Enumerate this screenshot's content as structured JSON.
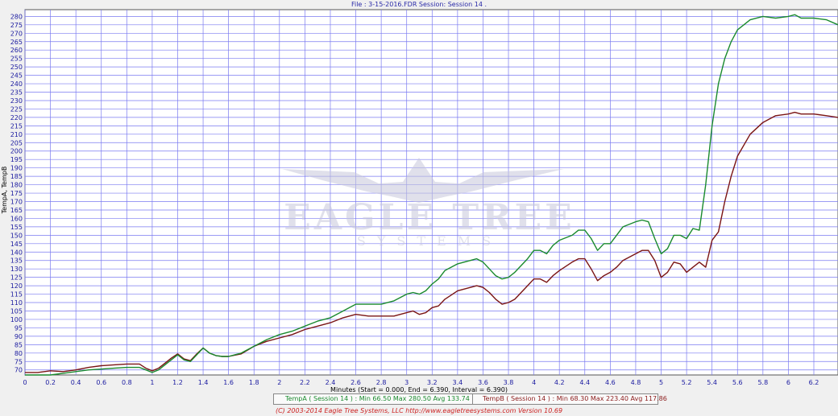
{
  "header": {
    "title": "File : 3-15-2016.FDR   Session: Session 14 ."
  },
  "legend": {
    "a": "TempA ( Session 14 ) : Min 66.50   Max 280.50   Avg 133.74",
    "b": "TempB ( Session 14 ) : Min 68.30   Max 223.40   Avg 117.86"
  },
  "footer": {
    "copyright": "(C) 2003-2014 Eagle Tree Systems, LLC  http://www.eagletreesystems.com  Version 10.69"
  },
  "watermark": {
    "line1": "EAGLE TREE",
    "line2": "SYSTEMS"
  },
  "colors": {
    "tempA": "#1a8a2e",
    "tempB": "#7a1414",
    "grid": "#7a7af0",
    "axis_text": "#1a1aa0"
  },
  "chart_data": {
    "type": "line",
    "title": "File : 3-15-2016.FDR   Session: Session 14 .",
    "xlabel": "Minutes (Start = 0.000,  End = 6.390,  Interval = 6.390)",
    "ylabel": "TempA, TempB",
    "xlim": [
      0,
      6.39
    ],
    "ylim": [
      67,
      284
    ],
    "grid": true,
    "x_ticks": [
      0,
      0.2,
      0.4,
      0.6,
      0.8,
      1,
      1.2,
      1.4,
      1.6,
      1.8,
      2,
      2.2,
      2.4,
      2.6,
      2.8,
      3,
      3.2,
      3.4,
      3.6,
      3.8,
      4,
      4.2,
      4.4,
      4.6,
      4.8,
      5,
      5.2,
      5.4,
      5.6,
      5.8,
      6,
      6.2
    ],
    "y_ticks": [
      70,
      75,
      80,
      85,
      90,
      95,
      100,
      105,
      110,
      115,
      120,
      125,
      130,
      135,
      140,
      145,
      150,
      155,
      160,
      165,
      170,
      175,
      180,
      185,
      190,
      195,
      200,
      205,
      210,
      215,
      220,
      225,
      230,
      235,
      240,
      245,
      250,
      255,
      260,
      265,
      270,
      275,
      280
    ],
    "series": [
      {
        "name": "TempA",
        "x": [
          0,
          0.1,
          0.2,
          0.3,
          0.4,
          0.5,
          0.6,
          0.7,
          0.8,
          0.85,
          0.9,
          0.95,
          1.0,
          1.05,
          1.1,
          1.15,
          1.2,
          1.25,
          1.3,
          1.35,
          1.4,
          1.45,
          1.5,
          1.55,
          1.6,
          1.7,
          1.8,
          1.9,
          2.0,
          2.1,
          2.2,
          2.3,
          2.4,
          2.5,
          2.6,
          2.7,
          2.8,
          2.9,
          3.0,
          3.05,
          3.1,
          3.15,
          3.2,
          3.25,
          3.3,
          3.4,
          3.5,
          3.55,
          3.6,
          3.65,
          3.7,
          3.75,
          3.8,
          3.85,
          3.9,
          3.95,
          4.0,
          4.05,
          4.1,
          4.15,
          4.2,
          4.3,
          4.35,
          4.4,
          4.45,
          4.5,
          4.55,
          4.6,
          4.65,
          4.7,
          4.8,
          4.85,
          4.9,
          4.95,
          5.0,
          5.05,
          5.1,
          5.15,
          5.2,
          5.25,
          5.3,
          5.35,
          5.4,
          5.45,
          5.5,
          5.55,
          5.6,
          5.7,
          5.8,
          5.9,
          6.0,
          6.05,
          6.1,
          6.2,
          6.3,
          6.39
        ],
        "y": [
          67,
          67,
          67,
          68,
          69,
          70,
          70.5,
          71,
          71.5,
          71.5,
          71.5,
          70,
          68.5,
          70,
          73,
          76,
          79,
          76,
          75,
          79,
          83,
          80,
          78.5,
          78,
          78,
          80,
          84,
          88,
          91,
          93,
          96,
          99,
          101,
          105,
          109,
          109,
          109,
          111,
          115,
          116,
          115,
          117,
          121,
          124,
          129,
          133,
          135,
          136,
          134,
          130,
          126,
          124,
          125,
          128,
          132,
          136,
          141,
          141,
          139,
          144,
          147,
          150,
          153,
          153,
          148,
          141,
          145,
          145,
          150,
          155,
          158,
          159,
          158,
          148,
          139,
          142,
          150,
          150,
          148,
          154,
          153,
          180,
          215,
          240,
          255,
          265,
          272,
          278,
          280,
          279,
          280,
          281,
          279,
          279,
          278,
          275
        ]
      },
      {
        "name": "TempB",
        "x": [
          0,
          0.1,
          0.2,
          0.3,
          0.4,
          0.5,
          0.6,
          0.7,
          0.8,
          0.85,
          0.9,
          0.95,
          1.0,
          1.05,
          1.1,
          1.15,
          1.2,
          1.25,
          1.3,
          1.35,
          1.4,
          1.45,
          1.5,
          1.55,
          1.6,
          1.7,
          1.8,
          1.9,
          2.0,
          2.1,
          2.2,
          2.3,
          2.4,
          2.5,
          2.6,
          2.7,
          2.8,
          2.9,
          3.0,
          3.05,
          3.1,
          3.15,
          3.2,
          3.25,
          3.3,
          3.4,
          3.5,
          3.55,
          3.6,
          3.65,
          3.7,
          3.75,
          3.8,
          3.85,
          3.9,
          3.95,
          4.0,
          4.05,
          4.1,
          4.15,
          4.2,
          4.3,
          4.35,
          4.4,
          4.45,
          4.5,
          4.55,
          4.6,
          4.65,
          4.7,
          4.8,
          4.85,
          4.9,
          4.95,
          5.0,
          5.05,
          5.1,
          5.15,
          5.2,
          5.25,
          5.3,
          5.35,
          5.4,
          5.45,
          5.5,
          5.55,
          5.6,
          5.7,
          5.8,
          5.9,
          6.0,
          6.05,
          6.1,
          6.2,
          6.3,
          6.39
        ],
        "y": [
          68.5,
          68.5,
          69.5,
          69,
          70,
          71.5,
          72.5,
          73,
          73.5,
          73.5,
          73.5,
          71,
          69.5,
          71,
          74,
          77,
          79.5,
          76.5,
          75.5,
          79.5,
          83,
          80,
          78.5,
          78,
          78,
          79.5,
          84,
          87,
          89,
          91,
          94,
          96,
          98,
          101,
          103,
          102,
          102,
          102,
          104,
          105,
          103,
          104,
          107,
          108,
          112,
          117,
          119,
          120,
          119,
          116,
          112,
          109,
          110,
          112,
          116,
          120,
          124,
          124,
          122,
          126,
          129,
          134,
          136,
          136,
          130,
          123,
          126,
          128,
          131,
          135,
          139,
          141,
          141,
          135,
          125,
          128,
          134,
          133,
          128,
          131,
          134,
          131,
          147,
          152,
          170,
          185,
          197,
          210,
          217,
          221,
          222,
          223,
          222,
          222,
          221,
          220
        ]
      }
    ]
  }
}
